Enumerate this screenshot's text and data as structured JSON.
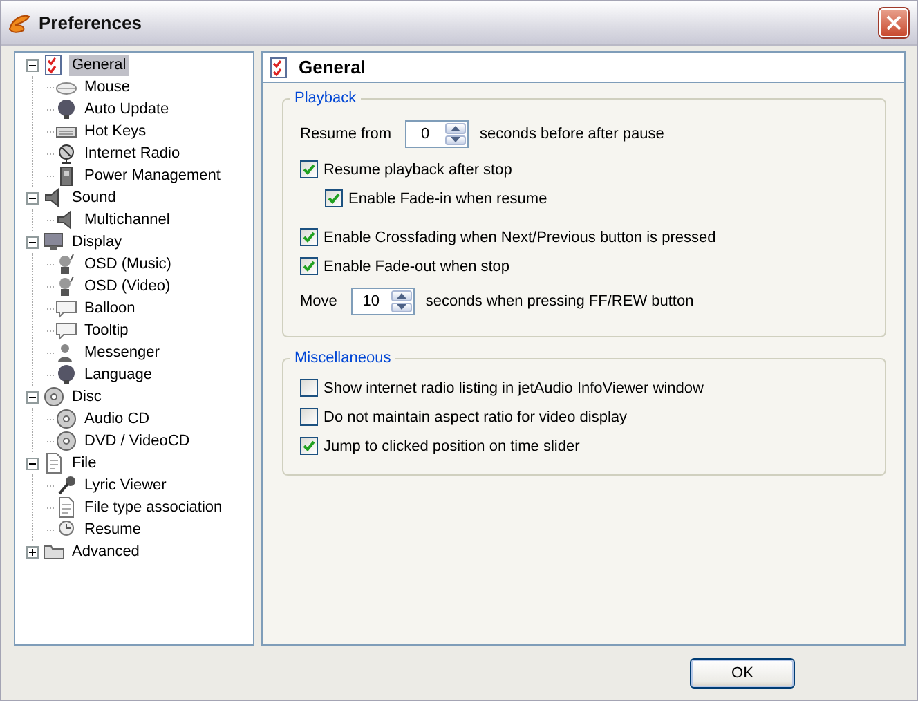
{
  "window": {
    "title": "Preferences"
  },
  "tree": [
    {
      "label": "General",
      "selected": true,
      "expanded": true,
      "children": [
        {
          "label": "Mouse",
          "selected": false
        },
        {
          "label": "Auto Update",
          "selected": false
        },
        {
          "label": "Hot Keys",
          "selected": false
        },
        {
          "label": "Internet Radio",
          "selected": false
        },
        {
          "label": "Power Management",
          "selected": false
        }
      ]
    },
    {
      "label": "Sound",
      "selected": false,
      "expanded": true,
      "children": [
        {
          "label": "Multichannel",
          "selected": false
        }
      ]
    },
    {
      "label": "Display",
      "selected": false,
      "expanded": true,
      "children": [
        {
          "label": "OSD (Music)",
          "selected": false
        },
        {
          "label": "OSD (Video)",
          "selected": false
        },
        {
          "label": "Balloon",
          "selected": false
        },
        {
          "label": "Tooltip",
          "selected": false
        },
        {
          "label": "Messenger",
          "selected": false
        },
        {
          "label": "Language",
          "selected": false
        }
      ]
    },
    {
      "label": "Disc",
      "selected": false,
      "expanded": true,
      "children": [
        {
          "label": "Audio CD",
          "selected": false
        },
        {
          "label": "DVD / VideoCD",
          "selected": false
        }
      ]
    },
    {
      "label": "File",
      "selected": false,
      "expanded": true,
      "children": [
        {
          "label": "Lyric Viewer",
          "selected": false
        },
        {
          "label": "File type association",
          "selected": false
        },
        {
          "label": "Resume",
          "selected": false
        }
      ]
    },
    {
      "label": "Advanced",
      "selected": false,
      "expanded": false
    }
  ],
  "panel": {
    "title": "General",
    "groups": [
      {
        "title": "Playback",
        "rows": [
          {
            "kind": "spin",
            "before": "Resume from",
            "value": "0",
            "after": "seconds before after pause"
          },
          {
            "kind": "checkbox",
            "label": "Resume playback after stop",
            "checked": true,
            "children": [
              {
                "kind": "checkbox",
                "label": "Enable Fade-in when resume",
                "checked": true
              }
            ]
          },
          {
            "kind": "checkbox",
            "label": "Enable Crossfading when Next/Previous button is pressed",
            "checked": true
          },
          {
            "kind": "checkbox",
            "label": "Enable Fade-out when stop",
            "checked": true
          },
          {
            "kind": "spin",
            "before": "Move",
            "value": "10",
            "after": "seconds when pressing FF/REW button"
          }
        ]
      },
      {
        "title": "Miscellaneous",
        "rows": [
          {
            "kind": "checkbox",
            "label": "Show internet radio listing in jetAudio InfoViewer window",
            "checked": false
          },
          {
            "kind": "checkbox",
            "label": "Do not maintain aspect ratio for video display",
            "checked": false
          },
          {
            "kind": "checkbox",
            "label": "Jump to clicked position on time slider",
            "checked": true
          }
        ]
      }
    ]
  },
  "buttons": [
    "OK"
  ]
}
